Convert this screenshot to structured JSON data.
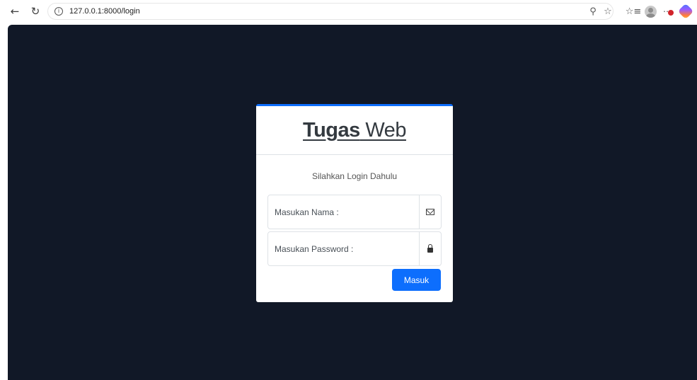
{
  "browser": {
    "url": "127.0.0.1:8000/login",
    "icons": [
      "back-icon",
      "reload-icon",
      "info-icon",
      "key-icon",
      "favorite-star-icon",
      "favorites-list-icon",
      "profile-avatar-icon",
      "more-icon",
      "copilot-icon"
    ]
  },
  "page": {
    "background_color": "#111827",
    "accent_color": "#0d6efd"
  },
  "login": {
    "brand_bold": "Tugas",
    "brand_light": " Web",
    "subtitle": "Silahkan Login Dahulu",
    "name_placeholder": "Masukan Nama :",
    "password_placeholder": "Masukan Password :",
    "submit_label": "Masuk"
  }
}
